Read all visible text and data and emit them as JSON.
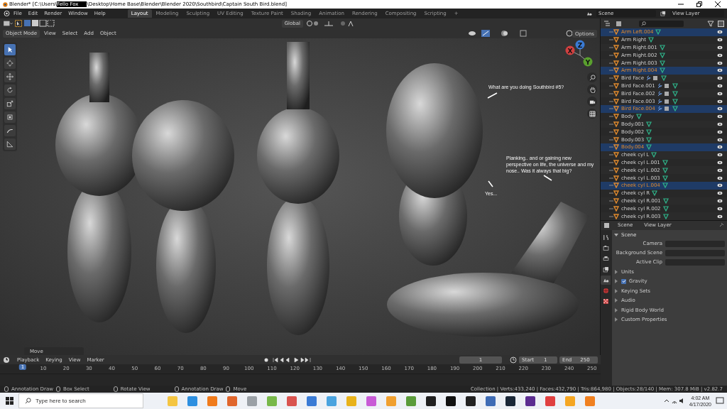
{
  "window": {
    "title_start": "Blender* [C:\\Users\\",
    "title_redacted": "Fello Fox",
    "title_end": "\\Desktop\\Home Base\\Blender\\Blender 2020\\Southbird\\Captain South Bird.blend]"
  },
  "menus": [
    "File",
    "Edit",
    "Render",
    "Window",
    "Help"
  ],
  "workspaces": [
    {
      "label": "Layout",
      "selected": true
    },
    {
      "label": "Modeling",
      "selected": false
    },
    {
      "label": "Sculpting",
      "selected": false
    },
    {
      "label": "UV Editing",
      "selected": false
    },
    {
      "label": "Texture Paint",
      "selected": false
    },
    {
      "label": "Shading",
      "selected": false
    },
    {
      "label": "Animation",
      "selected": false
    },
    {
      "label": "Rendering",
      "selected": false
    },
    {
      "label": "Compositing",
      "selected": false
    },
    {
      "label": "Scripting",
      "selected": false
    }
  ],
  "add_workspace": "+",
  "scene_field": "Scene",
  "view_layer_field": "View Layer",
  "viewport": {
    "mode": "Object Mode",
    "menus": [
      "View",
      "Select",
      "Add",
      "Object"
    ],
    "orientation": "Global",
    "options": "Options",
    "toolbar": [
      {
        "kind": "select",
        "selected": true
      },
      {
        "kind": "cursor",
        "selected": false
      },
      {
        "kind": "move",
        "selected": false
      },
      {
        "kind": "rotate",
        "selected": false
      },
      {
        "kind": "scale",
        "selected": false
      },
      {
        "kind": "transform",
        "selected": false
      },
      {
        "kind": "annotate",
        "selected": false
      },
      {
        "kind": "measure",
        "selected": false
      }
    ],
    "gizmo_axes": [
      "X",
      "Y",
      "Z"
    ],
    "speech": [
      "What are you doing Southbird #5?",
      "Planking.. and or gaining new perspective on life, the universe and my nose.. Was it always that big?",
      "Yes..."
    ],
    "last_operator": "Move"
  },
  "outliner": {
    "rows": [
      {
        "name": "Arm Left.004",
        "selected": true,
        "modifiers": false
      },
      {
        "name": "Arm Right",
        "selected": false,
        "modifiers": false
      },
      {
        "name": "Arm Right.001",
        "selected": false,
        "modifiers": false
      },
      {
        "name": "Arm Right.002",
        "selected": false,
        "modifiers": false
      },
      {
        "name": "Arm Right.003",
        "selected": false,
        "modifiers": false
      },
      {
        "name": "Arm Right.004",
        "selected": true,
        "modifiers": false
      },
      {
        "name": "Bird Face",
        "selected": false,
        "modifiers": true
      },
      {
        "name": "Bird Face.001",
        "selected": false,
        "modifiers": true
      },
      {
        "name": "Bird Face.002",
        "selected": false,
        "modifiers": true
      },
      {
        "name": "Bird Face.003",
        "selected": false,
        "modifiers": true
      },
      {
        "name": "Bird Face.004",
        "selected": true,
        "modifiers": true
      },
      {
        "name": "Body",
        "selected": false,
        "modifiers": false
      },
      {
        "name": "Body.001",
        "selected": false,
        "modifiers": false
      },
      {
        "name": "Body.002",
        "selected": false,
        "modifiers": false
      },
      {
        "name": "Body.003",
        "selected": false,
        "modifiers": false
      },
      {
        "name": "Body.004",
        "selected": true,
        "modifiers": false
      },
      {
        "name": "cheek cyl L",
        "selected": false,
        "modifiers": false
      },
      {
        "name": "cheek cyl L.001",
        "selected": false,
        "modifiers": false
      },
      {
        "name": "cheek cyl L.002",
        "selected": false,
        "modifiers": false
      },
      {
        "name": "cheek cyl L.003",
        "selected": false,
        "modifiers": false
      },
      {
        "name": "cheek cyl L.004",
        "selected": true,
        "modifiers": false
      },
      {
        "name": "cheek cyl R",
        "selected": false,
        "modifiers": false
      },
      {
        "name": "cheek cyl R.001",
        "selected": false,
        "modifiers": false
      },
      {
        "name": "cheek cyl R.002",
        "selected": false,
        "modifiers": false
      },
      {
        "name": "cheek cyl R.003",
        "selected": false,
        "modifiers": false
      }
    ]
  },
  "properties": {
    "breadcrumb": [
      "Scene",
      "View Layer"
    ],
    "tabs": [
      {
        "kind": "tool",
        "selected": false
      },
      {
        "kind": "render",
        "selected": false
      },
      {
        "kind": "output",
        "selected": false
      },
      {
        "kind": "view_layer",
        "selected": false
      },
      {
        "kind": "scene",
        "selected": true
      },
      {
        "kind": "world",
        "selected": false
      },
      {
        "kind": "texture",
        "selected": false
      }
    ],
    "panel": {
      "title": "Scene",
      "expanded": true,
      "fields": [
        "Camera",
        "Background Scene",
        "Active Clip"
      ]
    },
    "subpanels": [
      {
        "label": "Units",
        "expanded": false,
        "kind": "plain"
      },
      {
        "label": "Gravity",
        "expanded": false,
        "kind": "checkbox",
        "checked": true
      },
      {
        "label": "Keying Sets",
        "expanded": false,
        "kind": "plain"
      },
      {
        "label": "Audio",
        "expanded": false,
        "kind": "plain"
      },
      {
        "label": "Rigid Body World",
        "expanded": false,
        "kind": "plain"
      },
      {
        "label": "Custom Properties",
        "expanded": false,
        "kind": "plain"
      }
    ]
  },
  "timeline": {
    "menus": [
      "Playback",
      "Keying",
      "View",
      "Marker"
    ],
    "current_frame": "1",
    "start_label": "Start",
    "start": "1",
    "end_label": "End",
    "end": "250",
    "ruler": [
      "1",
      "10",
      "20",
      "30",
      "40",
      "50",
      "60",
      "70",
      "80",
      "90",
      "100",
      "110",
      "120",
      "130",
      "140",
      "150",
      "160",
      "170",
      "180",
      "190",
      "200",
      "210",
      "220",
      "230",
      "240",
      "250"
    ]
  },
  "status_bar": {
    "hints": [
      "Annotation Draw",
      "Box Select",
      "Rotate View",
      "Annotation Draw",
      "Move"
    ],
    "stats": "Collection | Verts:433,240 | Faces:432,790 | Tris:864,980 | Objects:28/140 | Mem: 307.8 MiB | v2.82.7"
  },
  "taskbar": {
    "search_placeholder": "Type here to search",
    "time": "4:02 AM",
    "date": "4/17/2020"
  }
}
